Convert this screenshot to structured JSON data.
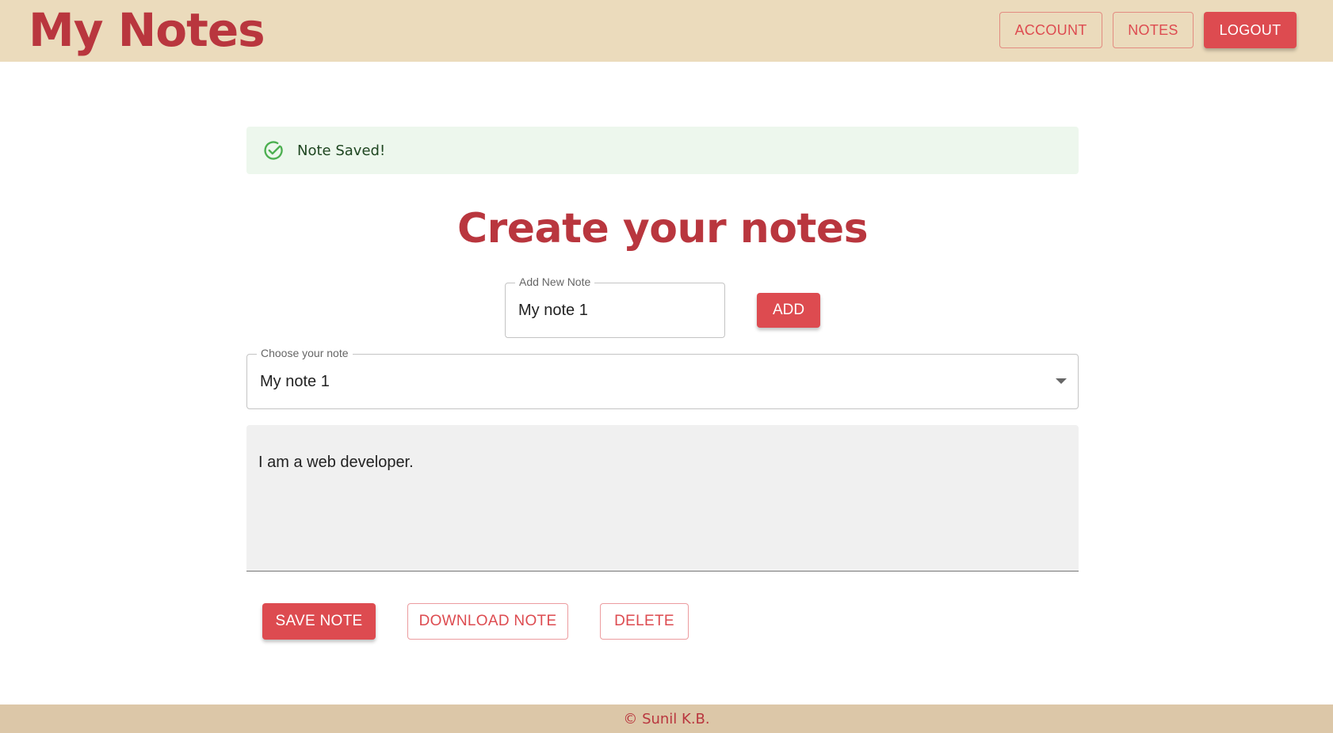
{
  "header": {
    "brand": "My Notes",
    "nav": {
      "account_label": "ACCOUNT",
      "notes_label": "NOTES",
      "logout_label": "LOGOUT"
    }
  },
  "alert": {
    "icon": "check-circle-icon",
    "message": "Note Saved!"
  },
  "main": {
    "title": "Create your notes",
    "new_note": {
      "label": "Add New Note",
      "value": "My note 1",
      "add_label": "ADD"
    },
    "choose_note": {
      "label": "Choose your note",
      "selected": "My note 1"
    },
    "note_content": "I am a web developer.",
    "actions": {
      "save_label": "SAVE NOTE",
      "download_label": "DOWNLOAD NOTE",
      "delete_label": "DELETE"
    }
  },
  "footer": {
    "text": "© Sunil K.B."
  },
  "colors": {
    "brand": "#b9363e",
    "accent": "#dd4b50",
    "header_bg": "#ebdbbc",
    "footer_bg": "#dcc7a8",
    "success_bg": "#edf7ed",
    "success_icon": "#4caf50"
  }
}
